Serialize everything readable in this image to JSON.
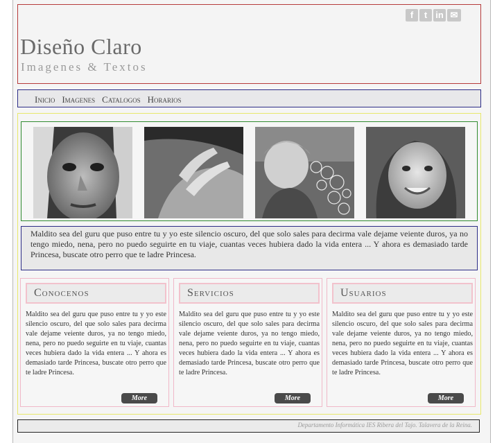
{
  "header": {
    "title": "Diseño Claro",
    "subtitle": "Imagenes & Textos",
    "social": [
      {
        "icon": "facebook-icon",
        "glyph": "f"
      },
      {
        "icon": "twitter-icon",
        "glyph": "t"
      },
      {
        "icon": "linkedin-icon",
        "glyph": "in"
      },
      {
        "icon": "mail-icon",
        "glyph": "✉"
      }
    ]
  },
  "nav": {
    "items": [
      "Inicio",
      "Imagenes",
      "Catalogos",
      "Horarios"
    ]
  },
  "gallery": {
    "photos": [
      "child-face-photo",
      "hands-photo",
      "child-bubbles-photo",
      "smiling-girl-photo"
    ]
  },
  "intro": {
    "text": "Maldito sea del guru que puso entre tu y yo este silencio oscuro, del que solo sales para decirma vale dejame veiente duros, ya no tengo miedo, nena, pero no puedo seguirte en tu viaje, cuantas veces hubiera dado la vida entera ... Y ahora es demasiado tarde Princesa, buscate otro perro que te ladre Princesa."
  },
  "columns": [
    {
      "heading": "Conocenos",
      "text": "Maldito sea del guru que puso entre tu y yo este silencio oscuro, del que solo sales para decirma vale dejame veiente duros, ya no tengo miedo, nena, pero no puedo seguirte en tu viaje, cuantas veces hubiera dado la vida entera ... Y ahora es demasiado tarde Princesa, buscate otro perro que te ladre Princesa.",
      "button": "More"
    },
    {
      "heading": "Servicios",
      "text": "Maldito sea del guru que puso entre tu y yo este silencio oscuro, del que solo sales para decirma vale dejame veiente duros, ya no tengo miedo, nena, pero no puedo seguirte en tu viaje, cuantas veces hubiera dado la vida entera ... Y ahora es demasiado tarde Princesa, buscate otro perro que te ladre Princesa.",
      "button": "More"
    },
    {
      "heading": "Usuarios",
      "text": "Maldito sea del guru que puso entre tu y yo este silencio oscuro, del que solo sales para decirma vale dejame veiente duros, ya no tengo miedo, nena, pero no puedo seguirte en tu viaje, cuantas veces hubiera dado la vida entera ... Y ahora es demasiado tarde Princesa, buscate otro perro que te ladre Princesa.",
      "button": "More"
    }
  ],
  "footer": {
    "text": "Departamento Informática IES Ribera del Tajo. Talavera de la Reina."
  },
  "colors": {
    "header_border": "#b53a3a",
    "nav_border": "#2b2b86",
    "content_border": "#e8e86a",
    "gallery_border": "#2f8a2f",
    "column_border": "#f0b8c8"
  }
}
